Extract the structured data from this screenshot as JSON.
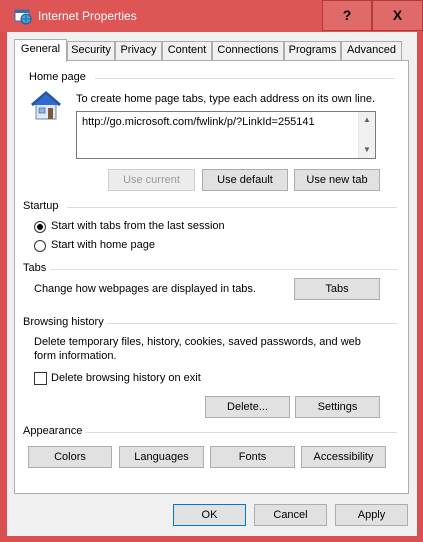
{
  "window": {
    "title": "Internet Properties",
    "help_label": "?",
    "close_label": "X"
  },
  "tabs": [
    {
      "label": "General",
      "active": true
    },
    {
      "label": "Security"
    },
    {
      "label": "Privacy"
    },
    {
      "label": "Content"
    },
    {
      "label": "Connections"
    },
    {
      "label": "Programs"
    },
    {
      "label": "Advanced"
    }
  ],
  "home_page": {
    "group_label": "Home page",
    "instruction": "To create home page tabs, type each address on its own line.",
    "url": "http://go.microsoft.com/fwlink/p/?LinkId=255141",
    "use_current_label": "Use current",
    "use_default_label": "Use default",
    "use_new_tab_label": "Use new tab",
    "icon": "house-icon"
  },
  "startup": {
    "group_label": "Startup",
    "option_last_session": "Start with tabs from the last session",
    "option_home_page": "Start with home page"
  },
  "tabs_section": {
    "group_label": "Tabs",
    "description": "Change how webpages are displayed in tabs.",
    "tabs_button_label": "Tabs"
  },
  "browsing_history": {
    "group_label": "Browsing history",
    "description": "Delete temporary files, history, cookies, saved passwords, and web form information.",
    "delete_on_exit_label": "Delete browsing history on exit",
    "delete_button_label": "Delete...",
    "settings_button_label": "Settings"
  },
  "appearance": {
    "group_label": "Appearance",
    "colors_label": "Colors",
    "languages_label": "Languages",
    "fonts_label": "Fonts",
    "accessibility_label": "Accessibility"
  },
  "footer": {
    "ok_label": "OK",
    "cancel_label": "Cancel",
    "apply_label": "Apply"
  },
  "colors": {
    "titlebar": "#dd5555",
    "focus_border": "#0078d7"
  }
}
